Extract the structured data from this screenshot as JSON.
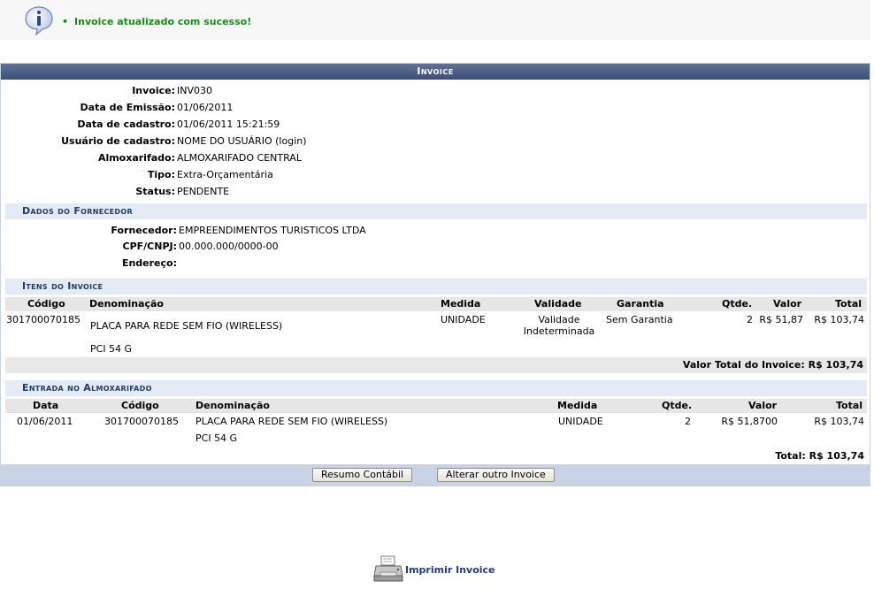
{
  "message": {
    "text": "Invoice atualizado com sucesso!",
    "color": "#1a8a1a"
  },
  "panel": {
    "title": "Invoice",
    "fields": [
      {
        "label": "Invoice:",
        "value": "INV030"
      },
      {
        "label": "Data de Emissão:",
        "value": "01/06/2011"
      },
      {
        "label": "Data de cadastro:",
        "value": "01/06/2011 15:21:59"
      },
      {
        "label": "Usuário de cadastro:",
        "value": "NOME DO USUÁRIO (login)"
      },
      {
        "label": "Almoxarifado:",
        "value": "ALMOXARIFADO CENTRAL"
      },
      {
        "label": "Tipo:",
        "value": "Extra-Orçamentária"
      },
      {
        "label": "Status:",
        "value": "PENDENTE"
      }
    ],
    "supplier": {
      "title": "Dados do Fornecedor",
      "fields": [
        {
          "label": "Fornecedor:",
          "value": "EMPREENDIMENTOS TURISTICOS LTDA"
        },
        {
          "label": "CPF/CNPJ:",
          "value": "00.000.000/0000-00"
        },
        {
          "label": "Endereço:",
          "value": ""
        }
      ]
    },
    "items": {
      "title": "Itens do Invoice",
      "headers": [
        "Código",
        "Denominação",
        "Medida",
        "Validade",
        "Garantia",
        "Qtde.",
        "Valor",
        "Total"
      ],
      "rows": [
        {
          "codigo": "301700070185",
          "denominacao": "PLACA PARA REDE SEM FIO (WIRELESS)",
          "denominacao_extra": "PCI 54 G",
          "medida": "UNIDADE",
          "validade_1": "Validade",
          "validade_2": "Indeterminada",
          "garantia": "Sem Garantia",
          "qtde": "2",
          "valor": "R$ 51,87",
          "total": "R$ 103,74"
        }
      ],
      "total_label": "Valor Total do Invoice: R$ 103,74"
    },
    "entrada": {
      "title": "Entrada no Almoxarifado",
      "headers": [
        "Data",
        "Código",
        "Denominação",
        "Medida",
        "Qtde.",
        "Valor",
        "Total"
      ],
      "rows": [
        {
          "data": "01/06/2011",
          "codigo": "301700070185",
          "denominacao": "PLACA PARA REDE SEM FIO (WIRELESS)",
          "denominacao_extra": "PCI 54 G",
          "medida": "UNIDADE",
          "qtde": "2",
          "valor": "R$ 51,8700",
          "total": "R$ 103,74"
        }
      ],
      "total_label": "Total: R$ 103,74"
    },
    "buttons": {
      "resumo": "Resumo Contábil",
      "alterar": "Alterar outro Invoice"
    }
  },
  "print": {
    "label": "Imprimir Invoice"
  },
  "colors": {
    "header": "#3c4f77",
    "subheader_bg": "#e4ebf5",
    "subheader_text": "#1e3c6e",
    "footer": "#c9d3e6"
  }
}
